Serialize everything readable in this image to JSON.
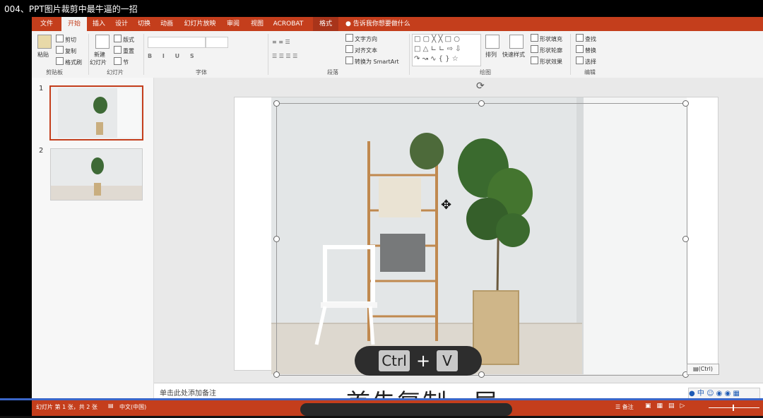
{
  "title_bar": {
    "title": "004、PPT图片裁剪中最牛逼的一招"
  },
  "tabs": [
    "文件",
    "开始",
    "插入",
    "设计",
    "切换",
    "动画",
    "幻灯片放映",
    "审阅",
    "视图",
    "ACROBAT",
    "格式"
  ],
  "tell_me": "告诉我你想要做什么",
  "clipboard": {
    "paste": "粘贴",
    "cut": "剪切",
    "copy": "复制",
    "format_painter": "格式刷",
    "group": "剪贴板"
  },
  "slides_group": {
    "new_slide": "新建",
    "new_slide2": "幻灯片",
    "layout": "版式",
    "reset": "重置",
    "section": "节",
    "group": "幻灯片"
  },
  "font_group": {
    "group": "字体"
  },
  "paragraph_group": {
    "text_direction": "文字方向",
    "align_text": "对齐文本",
    "smartart": "转换为 SmartArt",
    "group": "段落"
  },
  "drawing_group": {
    "arrange": "排列",
    "quick_styles": "快速样式",
    "shape_fill": "形状填充",
    "shape_outline": "形状轮廓",
    "shape_effects": "形状效果",
    "group": "绘图"
  },
  "editing_group": {
    "find": "查找",
    "replace": "替换",
    "select": "选择",
    "group": "编辑"
  },
  "thumbnails": [
    {
      "number": "1"
    },
    {
      "number": "2"
    }
  ],
  "shortcut": {
    "key1": "Ctrl",
    "plus": "+",
    "key2": "V"
  },
  "paste_options": "(Ctrl)",
  "notes_placeholder": "单击此处添加备注",
  "subtitle": "首先复制一层",
  "status": {
    "slide_info": "幻灯片 第 1 张，共 2 张",
    "language": "中文(中国)",
    "notes": "备注"
  },
  "colors": {
    "accent": "#c43e1c"
  }
}
